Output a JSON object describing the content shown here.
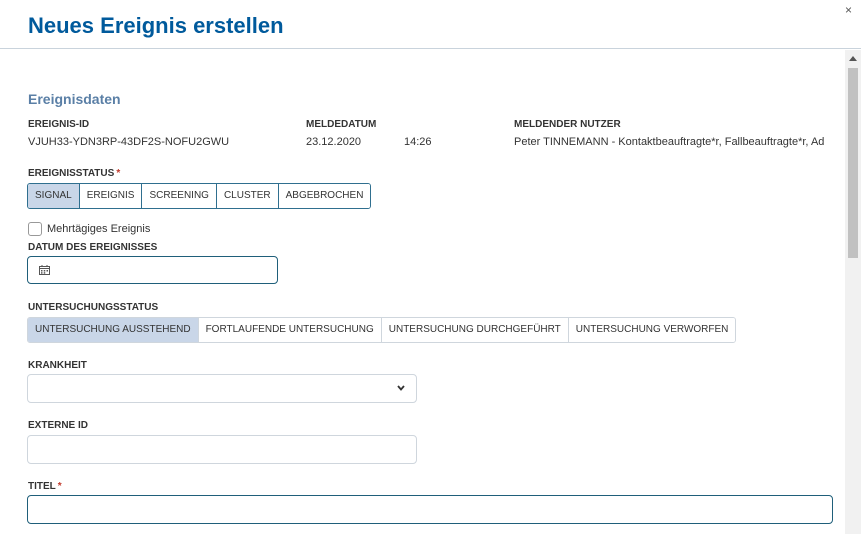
{
  "dialog": {
    "title": "Neues Ereignis erstellen",
    "close_label": "×"
  },
  "section": {
    "title": "Ereignisdaten"
  },
  "fields": {
    "event_id_label": "EREIGNIS-ID",
    "event_id_value": "VJUH33-YDN3RP-43DF2S-NOFU2GWU",
    "report_date_label": "MELDEDATUM",
    "report_date_value": "23.12.2020",
    "report_time_value": "14:26",
    "reporting_user_label": "MELDENDER NUTZER",
    "reporting_user_value": "Peter TINNEMANN - Kontaktbeauftragte*r, Fallbeauftragte*r, Ad",
    "event_status_label": "EREIGNISSTATUS",
    "required_marker": "*",
    "multiday_label": "Mehrtägiges Ereignis",
    "event_date_label": "DATUM DES EREIGNISSES",
    "investigation_status_label": "UNTERSUCHUNGSSTATUS",
    "disease_label": "KRANKHEIT",
    "external_id_label": "EXTERNE ID",
    "title_label": "TITEL"
  },
  "event_status_options": [
    {
      "label": "SIGNAL",
      "active": true
    },
    {
      "label": "EREIGNIS",
      "active": false
    },
    {
      "label": "SCREENING",
      "active": false
    },
    {
      "label": "CLUSTER",
      "active": false
    },
    {
      "label": "ABGEBROCHEN",
      "active": false
    }
  ],
  "investigation_status_options": [
    {
      "label": "UNTERSUCHUNG AUSSTEHEND",
      "active": true
    },
    {
      "label": "FORTLAUFENDE UNTERSUCHUNG",
      "active": false
    },
    {
      "label": "UNTERSUCHUNG DURCHGEFÜHRT",
      "active": false
    },
    {
      "label": "UNTERSUCHUNG VERWORFEN",
      "active": false
    }
  ],
  "colors": {
    "title": "#005a9c",
    "section_title": "#5a7fa6",
    "active_option": "#c9d6e8",
    "required": "#c0392b"
  },
  "icons": {
    "close": "close-icon",
    "calendar": "calendar-icon",
    "dropdown": "chevron-down-icon"
  }
}
